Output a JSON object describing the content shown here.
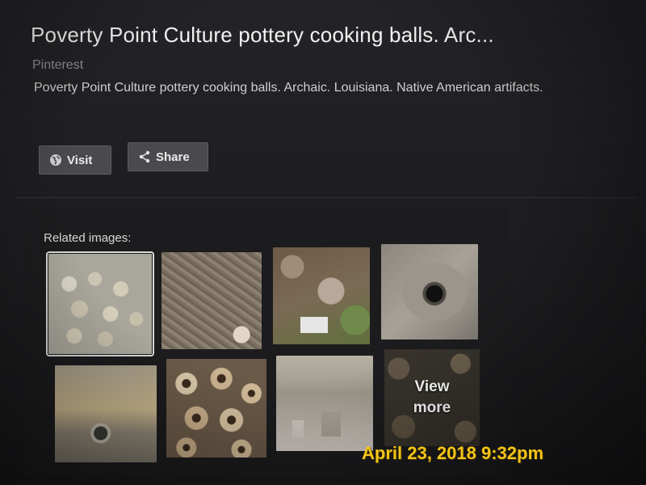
{
  "card": {
    "title": "Poverty Point Culture pottery cooking balls. Arc...",
    "source": "Pinterest",
    "description": "Poverty Point Culture pottery cooking balls. Archaic. Louisiana. Native American artifacts."
  },
  "actions": {
    "visit_label": "Visit",
    "visit_icon": "globe-icon",
    "share_label": "Share",
    "share_icon": "share-icon"
  },
  "related": {
    "heading": "Related images:",
    "view_more_line1": "View",
    "view_more_line2": "more",
    "thumbnail_count": 8
  },
  "photo_overlay": {
    "timestamp": "April 23, 2018 9:32pm",
    "color": "#f5c518"
  }
}
